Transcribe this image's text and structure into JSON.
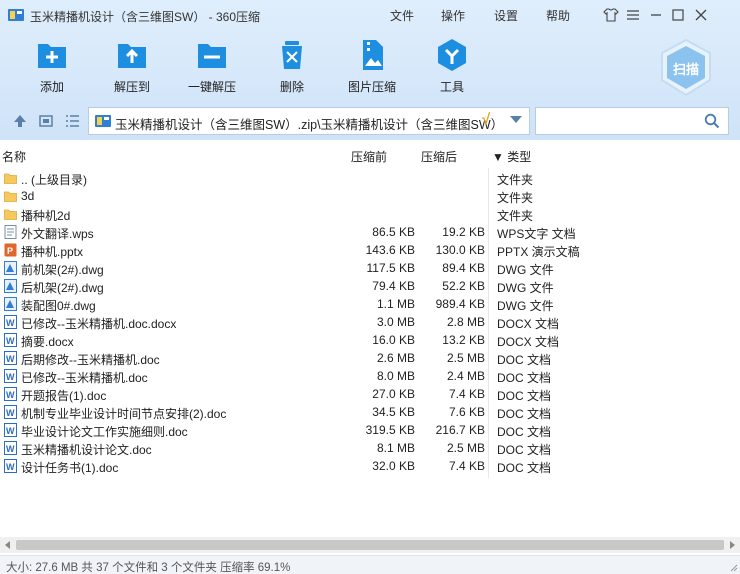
{
  "window": {
    "title": "玉米精播机设计（含三维图SW） - 360压缩",
    "menu": [
      "文件",
      "操作",
      "设置",
      "帮助"
    ]
  },
  "toolbar": {
    "add": "添加",
    "extract_to": "解压到",
    "one_click_extract": "一键解压",
    "delete": "删除",
    "image_compress": "图片压缩",
    "tools": "工具",
    "scan": "扫描"
  },
  "path": {
    "text": "玉米精播机设计（含三维图SW）.zip\\玉米精播机设计（含三维图SW）",
    "check": "√",
    "search_value": ""
  },
  "columns": {
    "name": "名称",
    "original_size": "压缩前",
    "compressed_size": "压缩后",
    "type": "▼ 类型"
  },
  "rows": [
    {
      "name": ".. (上级目录)",
      "orig": "",
      "comp": "",
      "type": "文件夹",
      "icon": "folder"
    },
    {
      "name": "3d",
      "orig": "",
      "comp": "",
      "type": "文件夹",
      "icon": "folder"
    },
    {
      "name": "播种机2d",
      "orig": "",
      "comp": "",
      "type": "文件夹",
      "icon": "folder"
    },
    {
      "name": "外文翻译.wps",
      "orig": "86.5 KB",
      "comp": "19.2 KB",
      "type": "WPS文字 文档",
      "icon": "wps"
    },
    {
      "name": "播种机.pptx",
      "orig": "143.6 KB",
      "comp": "130.0 KB",
      "type": "PPTX 演示文稿",
      "icon": "pptx"
    },
    {
      "name": "前机架(2#).dwg",
      "orig": "117.5 KB",
      "comp": "89.4 KB",
      "type": "DWG 文件",
      "icon": "dwg"
    },
    {
      "name": "后机架(2#).dwg",
      "orig": "79.4 KB",
      "comp": "52.2 KB",
      "type": "DWG 文件",
      "icon": "dwg"
    },
    {
      "name": "装配图0#.dwg",
      "orig": "1.1 MB",
      "comp": "989.4 KB",
      "type": "DWG 文件",
      "icon": "dwg"
    },
    {
      "name": "已修改--玉米精播机.doc.docx",
      "orig": "3.0 MB",
      "comp": "2.8 MB",
      "type": "DOCX 文档",
      "icon": "doc"
    },
    {
      "name": "摘要.docx",
      "orig": "16.0 KB",
      "comp": "13.2 KB",
      "type": "DOCX 文档",
      "icon": "doc"
    },
    {
      "name": "后期修改--玉米精播机.doc",
      "orig": "2.6 MB",
      "comp": "2.5 MB",
      "type": "DOC 文档",
      "icon": "doc"
    },
    {
      "name": "已修改--玉米精播机.doc",
      "orig": "8.0 MB",
      "comp": "2.4 MB",
      "type": "DOC 文档",
      "icon": "doc"
    },
    {
      "name": "开题报告(1).doc",
      "orig": "27.0 KB",
      "comp": "7.4 KB",
      "type": "DOC 文档",
      "icon": "doc"
    },
    {
      "name": "机制专业毕业设计时间节点安排(2).doc",
      "orig": "34.5 KB",
      "comp": "7.6 KB",
      "type": "DOC 文档",
      "icon": "doc"
    },
    {
      "name": "毕业设计论文工作实施细则.doc",
      "orig": "319.5 KB",
      "comp": "216.7 KB",
      "type": "DOC 文档",
      "icon": "doc"
    },
    {
      "name": "玉米精播机设计论文.doc",
      "orig": "8.1 MB",
      "comp": "2.5 MB",
      "type": "DOC 文档",
      "icon": "doc"
    },
    {
      "name": "设计任务书(1).doc",
      "orig": "32.0 KB",
      "comp": "7.4 KB",
      "type": "DOC 文档",
      "icon": "doc"
    }
  ],
  "status": {
    "text": "大小: 27.6 MB 共 37 个文件和 3 个文件夹 压缩率 69.1%"
  },
  "colors": {
    "toolbar_bg": "#d7e8fa",
    "icon_blue": "#1e8ee0",
    "folder": "#f7c95c",
    "pptx": "#e0662b",
    "doc": "#2b6cc4"
  }
}
